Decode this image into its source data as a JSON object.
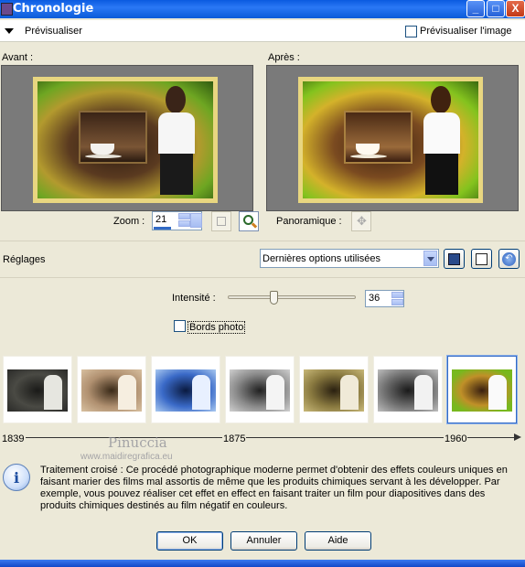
{
  "window": {
    "title": "Chronologie",
    "controls": [
      "_",
      "□",
      "X"
    ]
  },
  "top": {
    "preview_label": "Prévisualiser",
    "preview_image_label": "Prévisualiser l'image"
  },
  "before_label": "Avant :",
  "after_label": "Après :",
  "zoom": {
    "label": "Zoom :",
    "value": "21"
  },
  "pan_label": "Panoramique :",
  "settings": {
    "label": "Réglages",
    "preset": "Dernières options utilisées"
  },
  "intensity": {
    "label": "Intensité :",
    "value": "36",
    "level": 0.36
  },
  "photo_borders_label": "Bords photo",
  "timeline": {
    "years": [
      "1839",
      "1875",
      "1960"
    ],
    "selected_index": 6
  },
  "watermark": {
    "line1": "Pinuccia",
    "line2": "www.maidiregrafica.eu"
  },
  "description": "Traitement croisé : Ce procédé photographique moderne permet d'obtenir des effets couleurs uniques en faisant marier des films mal assortis de même que les produits chimiques servant à les développer. Par exemple, vous pouvez réaliser cet effet en  effect en faisant traiter un film pour diapositives dans des produits chimiques destinés au film négatif en couleurs.",
  "buttons": {
    "ok": "OK",
    "cancel": "Annuler",
    "help": "Aide"
  },
  "colors": {
    "title_bar": "#0a5ae0",
    "frame": "#e8d680",
    "selection": "#316ac5"
  }
}
